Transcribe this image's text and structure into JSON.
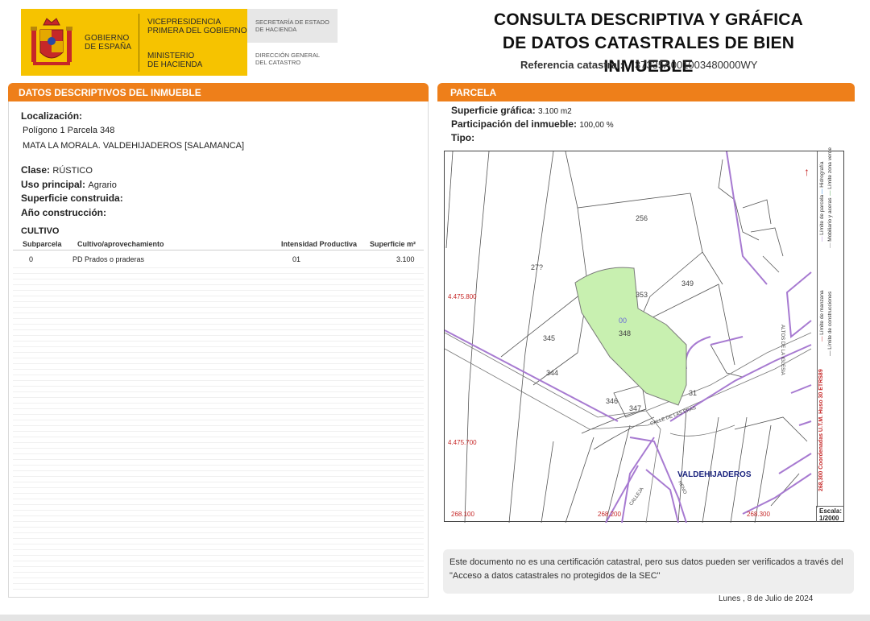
{
  "header": {
    "logo_gobierno": [
      "GOBIERNO",
      "DE ESPAÑA"
    ],
    "logo_vice": [
      "VICEPRESIDENCIA",
      "PRIMERA DEL GOBIERNO"
    ],
    "logo_ministerio": [
      "MINISTERIO",
      "DE HACIENDA"
    ],
    "secretaria": [
      "SECRETARÍA DE ESTADO",
      "DE HACIENDA"
    ],
    "direccion": [
      "DIRECCIÓN GENERAL",
      "DEL CATASTRO"
    ],
    "title": [
      "CONSULTA DESCRIPTIVA Y GRÁFICA",
      "DE DATOS CATASTRALES DE BIEN INMUEBLE"
    ],
    "ref_label": "Referencia catastral:",
    "ref_value": "37335A001003480000WY"
  },
  "left": {
    "section_title": "DATOS DESCRIPTIVOS DEL INMUEBLE",
    "localizacion_label": "Localización:",
    "localizacion_lines": [
      "Polígono 1 Parcela 348",
      "MATA LA MORALA. VALDEHIJADEROS [SALAMANCA]"
    ],
    "clase_label": "Clase:",
    "clase_value": "RÚSTICO",
    "uso_label": "Uso principal:",
    "uso_value": "Agrario",
    "sup_construida_label": "Superficie construida:",
    "anio_label": "Año construcción:",
    "cultivo": {
      "title": "CULTIVO",
      "headers": [
        "Subparcela",
        "Cultivo/aprovechamiento",
        "Intensidad Productiva",
        "Superficie m²"
      ],
      "rows": [
        [
          "0",
          "PD Prados o praderas",
          "01",
          "3.100"
        ]
      ]
    }
  },
  "right": {
    "section_title": "PARCELA",
    "sup_grafica_label": "Superficie gráfica:",
    "sup_grafica_value": "3.100 m2",
    "participacion_label": "Participación del inmueble:",
    "participacion_value": "100,00 %",
    "tipo_label": "Tipo:",
    "map": {
      "parcel_labels": [
        "256",
        "349",
        "353",
        "345",
        "344",
        "346",
        "347",
        "00",
        "348",
        "31"
      ],
      "partial_label": "27?",
      "place_label": "VALDEHIJADEROS",
      "street_labels": [
        "ALTOS DE LA IGLESIA",
        "CALLEJA",
        "HENO",
        "CALLE DE LAS ERAS"
      ],
      "coord_labels": [
        "4.475.800",
        "4.475.700",
        "268.100",
        "268.200",
        "268.300"
      ],
      "legend": [
        "Límite de manzana",
        "Límite de parcela",
        "Hidrografía",
        "Límite de construcciones",
        "Mobiliario y aceras",
        "Límite zona verde"
      ],
      "coord_note": "268,300 Coordenadas U.T.M. Huso 30 ETRS89",
      "scale_label": "Escala:",
      "scale_value": "1/2000",
      "colors": {
        "parcel_fill": "#c8f0b0",
        "boundary": "#a77ad1",
        "lines": "#444444",
        "coords": "#c62828"
      }
    }
  },
  "notice": "Este documento no es una certificación catastral, pero sus datos pueden ser verificados a través del \"Acceso a datos catastrales no protegidos de la SEC\"",
  "date": "Lunes , 8 de Julio de 2024"
}
